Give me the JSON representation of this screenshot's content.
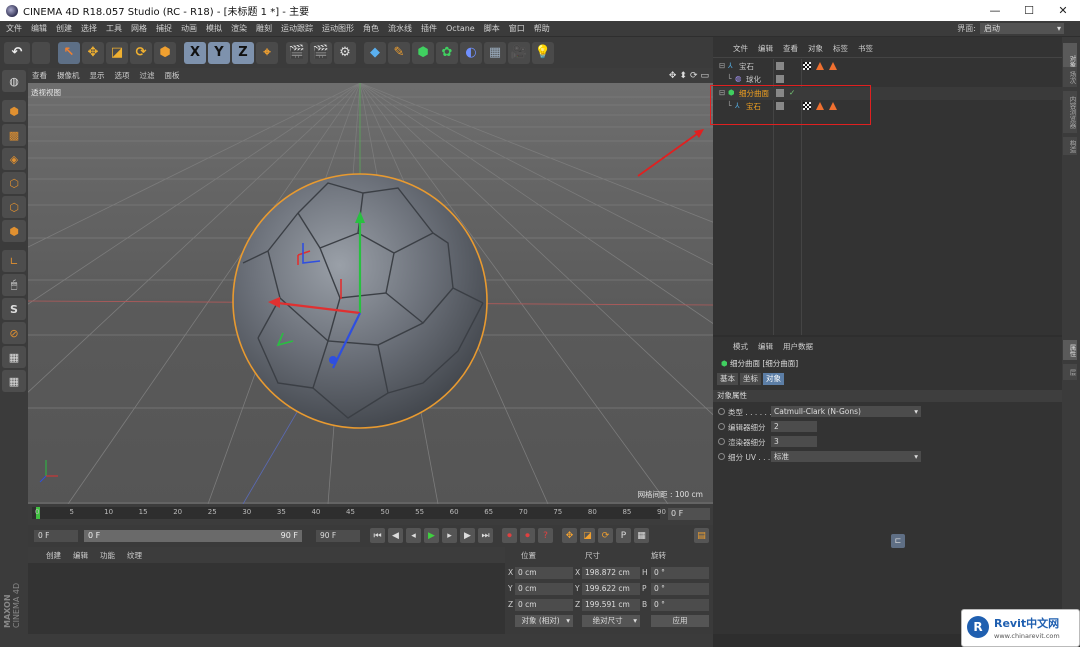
{
  "window": {
    "title": "CINEMA 4D R18.057 Studio (RC - R18) - [未标题 1 *] - 主要",
    "controls": [
      "—",
      "☐",
      "✕"
    ]
  },
  "menubar": {
    "items": [
      "文件",
      "编辑",
      "创建",
      "选择",
      "工具",
      "网格",
      "捕捉",
      "动画",
      "模拟",
      "渲染",
      "雕刻",
      "运动跟踪",
      "运动图形",
      "角色",
      "流水线",
      "插件",
      "Octane",
      "脚本",
      "窗口",
      "帮助"
    ]
  },
  "layout": {
    "label": "界面:",
    "value": "启动"
  },
  "toolbar": {
    "undo": "↶",
    "axes": [
      "X",
      "Y",
      "Z"
    ]
  },
  "viewport": {
    "menu": [
      "查看",
      "摄像机",
      "显示",
      "选项",
      "过滤",
      "面板"
    ],
    "label": "透视视图",
    "grid_spacing": "网格间距 : 100 cm",
    "nav_icons": [
      "✥",
      "⬍",
      "⟳",
      "▭"
    ]
  },
  "timeline": {
    "ticks": [
      "0",
      "5",
      "10",
      "15",
      "20",
      "25",
      "30",
      "35",
      "40",
      "45",
      "50",
      "55",
      "60",
      "65",
      "70",
      "75",
      "80",
      "85",
      "90"
    ],
    "current_frame": "0 F"
  },
  "playback": {
    "start": "0 F",
    "range_start": "0 F",
    "range_end": "90 F",
    "end": "90 F"
  },
  "material_manager": {
    "menu": [
      "创建",
      "编辑",
      "功能",
      "纹理"
    ]
  },
  "coordinates": {
    "headers": [
      "位置",
      "尺寸",
      "旋转"
    ],
    "rows": [
      {
        "axis": "X",
        "pos": "0 cm",
        "size_axis": "X",
        "size": "198.872 cm",
        "rot_axis": "H",
        "rot": "0 °"
      },
      {
        "axis": "Y",
        "pos": "0 cm",
        "size_axis": "Y",
        "size": "199.622 cm",
        "rot_axis": "P",
        "rot": "0 °"
      },
      {
        "axis": "Z",
        "pos": "0 cm",
        "size_axis": "Z",
        "size": "199.591 cm",
        "rot_axis": "B",
        "rot": "0 °"
      }
    ],
    "mode": "对象 (相对)",
    "size_mode": "绝对尺寸",
    "apply": "应用"
  },
  "object_manager": {
    "menu": [
      "文件",
      "编辑",
      "查看",
      "对象",
      "标签",
      "书签"
    ],
    "objects": [
      {
        "name": "宝石",
        "color": "#c8c8c8",
        "indent": 0
      },
      {
        "name": "球化",
        "color": "#c8c8c8",
        "indent": 1
      },
      {
        "name": "细分曲面",
        "color": "#f0a020",
        "indent": 0
      },
      {
        "name": "宝石",
        "color": "#f0a020",
        "indent": 1
      }
    ]
  },
  "attribute_manager": {
    "menu": [
      "模式",
      "编辑",
      "用户数据"
    ],
    "object_title": "细分曲面 [细分曲面]",
    "tabs": [
      "基本",
      "坐标",
      "对象"
    ],
    "section": "对象属性",
    "fields": [
      {
        "label": "类型 . . . . . .",
        "value": "Catmull-Clark (N-Gons)",
        "dropdown": true
      },
      {
        "label": "编辑器细分",
        "value": "2",
        "dropdown": false
      },
      {
        "label": "渲染器细分",
        "value": "3",
        "dropdown": false
      },
      {
        "label": "细分 UV . . .",
        "value": "标准",
        "dropdown": true
      }
    ]
  },
  "side_tabs": [
    "对象",
    "场次",
    "内容浏览器",
    "构造",
    "属性",
    "层"
  ],
  "brand": {
    "maxon": "MAXON",
    "c4d": "CINEMA 4D"
  },
  "watermark": {
    "name": "Revit中文网",
    "url": "www.chinarevit.com"
  },
  "colors": {
    "accent": "#f0a020",
    "selection": "#5c7ea6",
    "highlight_box": "#e02020"
  }
}
